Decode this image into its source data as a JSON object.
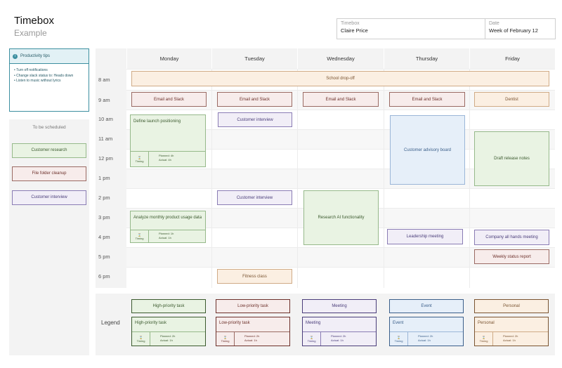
{
  "header": {
    "title": "Timebox",
    "subtitle": "Example"
  },
  "info": {
    "timebox_label": "Timebox",
    "timebox_value": "Claire Price",
    "date_label": "Date",
    "date_value": "Week of February 12"
  },
  "tips": {
    "title": "Productivity tips",
    "icon": "info-icon",
    "items": [
      "Turn off notifications",
      "Change slack status to: Heads down",
      "Listen to music without lyrics"
    ]
  },
  "to_be_scheduled": {
    "title": "To be scheduled",
    "items": [
      {
        "label": "Customer research",
        "category": "high-priority"
      },
      {
        "label": "File folder cleanup",
        "category": "low-priority"
      },
      {
        "label": "Customer interview",
        "category": "meeting"
      }
    ]
  },
  "days": [
    "Monday",
    "Tuesday",
    "Wednesday",
    "Thursday",
    "Friday"
  ],
  "times": [
    "8 am",
    "9 am",
    "10 am",
    "11 am",
    "12 pm",
    "1 pm",
    "2 pm",
    "3 pm",
    "4 pm",
    "5 pm",
    "6 pm"
  ],
  "events": {
    "school": "School drop-off",
    "mon_email": "Email and Slack",
    "tue_email": "Email and Slack",
    "wed_email": "Email and Slack",
    "thu_email": "Email and Slack",
    "fri_dentist": "Dentist",
    "mon_launch": {
      "label": "Define launch positioning",
      "timing": "Timing",
      "planned": "Planned: 4h",
      "actual": "Actual: 4h"
    },
    "tue_interview": "Customer interview",
    "thu_board": "Customer advisory board",
    "fri_notes": "Draft release notes",
    "tue_interview2": "Customer interview",
    "wed_research": "Research AI functionality",
    "mon_usage": {
      "label": "Analyze monthly product usage data",
      "timing": "Timing",
      "planned": "Planned: 1h",
      "actual": "Actual: 1h"
    },
    "thu_leadership": "Leadership meeting",
    "fri_allhands": "Company all hands meeting",
    "fri_weekly": "Weekly status report",
    "tue_fitness": "Fitness class"
  },
  "legend": {
    "label": "Legend",
    "items": [
      {
        "top": "High-priority task",
        "card": "High-priority task",
        "timing": "Timing",
        "planned": "Planned: 2h",
        "actual": "Actual: 1h"
      },
      {
        "top": "Low-priority task",
        "card": "Low-priority task",
        "timing": "Timing",
        "planned": "Planned: 2h",
        "actual": "Actual: 1h"
      },
      {
        "top": "Meeting",
        "card": "Meeting",
        "timing": "Timing",
        "planned": "Planned: 2h",
        "actual": "Actual: 1h"
      },
      {
        "top": "Event",
        "card": "Event",
        "timing": "Timing",
        "planned": "Planned: 2h",
        "actual": "Actual: 1h"
      },
      {
        "top": "Personal",
        "card": "Personal",
        "timing": "Timing",
        "planned": "Planned: 2h",
        "actual": "Actual: 1h"
      }
    ]
  }
}
